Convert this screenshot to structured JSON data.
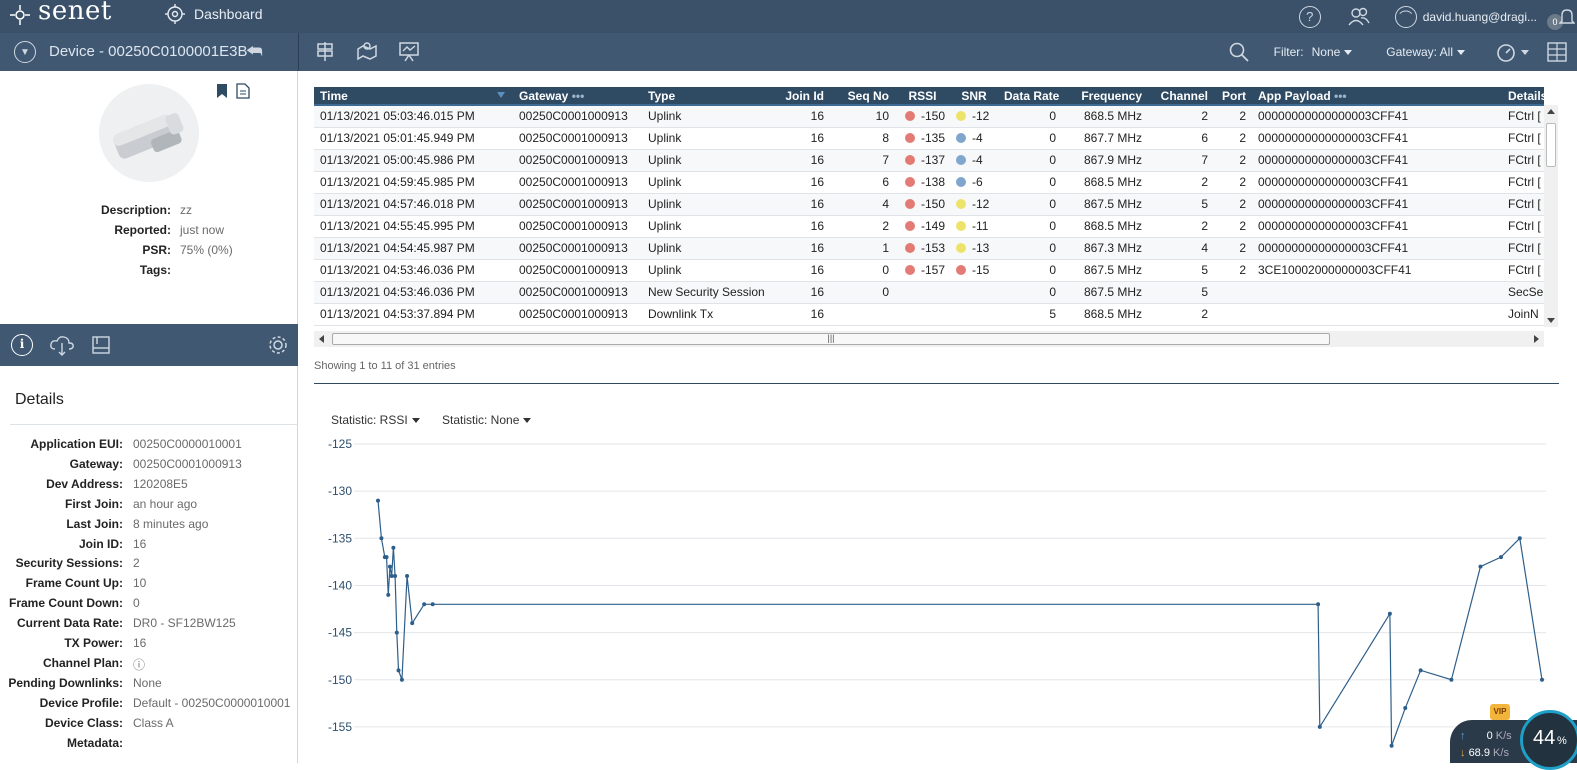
{
  "topbar": {
    "brand": "senet",
    "dashboard_label": "Dashboard",
    "user": "david.huang@dragi...",
    "notification_count": "0"
  },
  "subbar": {
    "device_title": "Device - 00250C0100001E3B",
    "filter_label": "Filter:",
    "filter_value": "None",
    "gateway_label": "Gateway: All"
  },
  "device_summary": [
    {
      "label": "Description:",
      "value": "zz"
    },
    {
      "label": "Reported:",
      "value": "just now"
    },
    {
      "label": "PSR:",
      "value": "75% (0%)"
    },
    {
      "label": "Tags:",
      "value": ""
    }
  ],
  "details": {
    "title": "Details",
    "rows": [
      {
        "label": "Application EUI:",
        "value": "00250C0000010001"
      },
      {
        "label": "Gateway:",
        "value": "00250C0001000913"
      },
      {
        "label": "Dev Address:",
        "value": "120208E5"
      },
      {
        "label": "First Join:",
        "value": "an hour ago"
      },
      {
        "label": "Last Join:",
        "value": "8 minutes ago"
      },
      {
        "label": "Join ID:",
        "value": "16"
      },
      {
        "label": "Security Sessions:",
        "value": "2"
      },
      {
        "label": "Frame Count Up:",
        "value": "10"
      },
      {
        "label": "Frame Count Down:",
        "value": "0"
      },
      {
        "label": "Current Data Rate:",
        "value": "DR0 - SF12BW125"
      },
      {
        "label": "TX Power:",
        "value": "16"
      },
      {
        "label": "Channel Plan:",
        "value": "ⓘ"
      },
      {
        "label": "Pending Downlinks:",
        "value": "None"
      },
      {
        "label": "Device Profile:",
        "value": "Default - 00250C0000010001"
      },
      {
        "label": "Device Class:",
        "value": "Class A"
      },
      {
        "label": "Metadata:",
        "value": ""
      }
    ]
  },
  "table": {
    "columns": [
      "Time",
      "Gateway",
      "Type",
      "Join Id",
      "Seq No",
      "RSSI",
      "SNR",
      "Data Rate",
      "Frequency",
      "Channel",
      "Port",
      "App Payload",
      "Details"
    ],
    "rows": [
      {
        "time": "01/13/2021 05:03:46.015 PM",
        "gateway": "00250C0001000913",
        "type": "Uplink",
        "join": "16",
        "seq": "10",
        "rssi": "-150",
        "rssi_color": "#e37b74",
        "snr": "-12",
        "snr_color": "#eee36a",
        "dr": "0",
        "freq": "868.5 MHz",
        "ch": "2",
        "port": "2",
        "payload": "00000000000000003CFF41",
        "details": "FCtrl ["
      },
      {
        "time": "01/13/2021 05:01:45.949 PM",
        "gateway": "00250C0001000913",
        "type": "Uplink",
        "join": "16",
        "seq": "8",
        "rssi": "-135",
        "rssi_color": "#e37b74",
        "snr": "-4",
        "snr_color": "#7fa6cd",
        "dr": "0",
        "freq": "867.7 MHz",
        "ch": "6",
        "port": "2",
        "payload": "00000000000000003CFF41",
        "details": "FCtrl ["
      },
      {
        "time": "01/13/2021 05:00:45.986 PM",
        "gateway": "00250C0001000913",
        "type": "Uplink",
        "join": "16",
        "seq": "7",
        "rssi": "-137",
        "rssi_color": "#e37b74",
        "snr": "-4",
        "snr_color": "#7fa6cd",
        "dr": "0",
        "freq": "867.9 MHz",
        "ch": "7",
        "port": "2",
        "payload": "00000000000000003CFF41",
        "details": "FCtrl ["
      },
      {
        "time": "01/13/2021 04:59:45.985 PM",
        "gateway": "00250C0001000913",
        "type": "Uplink",
        "join": "16",
        "seq": "6",
        "rssi": "-138",
        "rssi_color": "#e37b74",
        "snr": "-6",
        "snr_color": "#7fa6cd",
        "dr": "0",
        "freq": "868.5 MHz",
        "ch": "2",
        "port": "2",
        "payload": "00000000000000003CFF41",
        "details": "FCtrl ["
      },
      {
        "time": "01/13/2021 04:57:46.018 PM",
        "gateway": "00250C0001000913",
        "type": "Uplink",
        "join": "16",
        "seq": "4",
        "rssi": "-150",
        "rssi_color": "#e37b74",
        "snr": "-12",
        "snr_color": "#eee36a",
        "dr": "0",
        "freq": "867.5 MHz",
        "ch": "5",
        "port": "2",
        "payload": "00000000000000003CFF41",
        "details": "FCtrl ["
      },
      {
        "time": "01/13/2021 04:55:45.995 PM",
        "gateway": "00250C0001000913",
        "type": "Uplink",
        "join": "16",
        "seq": "2",
        "rssi": "-149",
        "rssi_color": "#e37b74",
        "snr": "-11",
        "snr_color": "#eee36a",
        "dr": "0",
        "freq": "868.5 MHz",
        "ch": "2",
        "port": "2",
        "payload": "00000000000000003CFF41",
        "details": "FCtrl ["
      },
      {
        "time": "01/13/2021 04:54:45.987 PM",
        "gateway": "00250C0001000913",
        "type": "Uplink",
        "join": "16",
        "seq": "1",
        "rssi": "-153",
        "rssi_color": "#e37b74",
        "snr": "-13",
        "snr_color": "#eee36a",
        "dr": "0",
        "freq": "867.3 MHz",
        "ch": "4",
        "port": "2",
        "payload": "00000000000000003CFF41",
        "details": "FCtrl ["
      },
      {
        "time": "01/13/2021 04:53:46.036 PM",
        "gateway": "00250C0001000913",
        "type": "Uplink",
        "join": "16",
        "seq": "0",
        "rssi": "-157",
        "rssi_color": "#e37b74",
        "snr": "-15",
        "snr_color": "#e37b74",
        "dr": "0",
        "freq": "867.5 MHz",
        "ch": "5",
        "port": "2",
        "payload": "3CE10002000000003CFF41",
        "details": "FCtrl ["
      },
      {
        "time": "01/13/2021 04:53:46.036 PM",
        "gateway": "00250C0001000913",
        "type": "New Security Session",
        "join": "16",
        "seq": "0",
        "rssi": "",
        "rssi_color": "",
        "snr": "",
        "snr_color": "",
        "dr": "0",
        "freq": "867.5 MHz",
        "ch": "5",
        "port": "",
        "payload": "",
        "details": "SecSe"
      },
      {
        "time": "01/13/2021 04:53:37.894 PM",
        "gateway": "00250C0001000913",
        "type": "Downlink Tx",
        "join": "16",
        "seq": "",
        "rssi": "",
        "rssi_color": "",
        "snr": "",
        "snr_color": "",
        "dr": "5",
        "freq": "868.5 MHz",
        "ch": "2",
        "port": "",
        "payload": "",
        "details": "JoinN"
      }
    ],
    "showing": "Showing 1 to 11 of 31 entries"
  },
  "statistics": {
    "primary": "Statistic: RSSI",
    "secondary": "Statistic: None"
  },
  "chart_data": {
    "type": "line",
    "ylim": [
      -157,
      -125
    ],
    "yticks": [
      -125,
      -130,
      -135,
      -140,
      -145,
      -150,
      -155
    ],
    "line_color": "#2e5f8a",
    "series": [
      {
        "x": [
          0,
          2,
          4,
          5,
          6,
          7,
          8,
          9,
          10,
          11,
          12,
          14,
          17,
          20,
          27,
          32,
          550,
          551,
          592,
          593,
          601,
          610,
          628,
          645,
          657,
          668,
          681
        ],
        "values": [
          -131,
          -135,
          -137,
          -137,
          -141,
          -138,
          -139,
          -136,
          -139,
          -145,
          -149,
          -150,
          -139,
          -144,
          -142,
          -142,
          -142,
          -155,
          -143,
          -157,
          -153,
          -149,
          -150,
          -138,
          -137,
          -135,
          -150
        ]
      }
    ]
  },
  "speed_widget": {
    "up": "0",
    "up_unit": "K/s",
    "down": "68.9",
    "down_unit": "K/s",
    "percent": "44",
    "percent_unit": "%"
  }
}
